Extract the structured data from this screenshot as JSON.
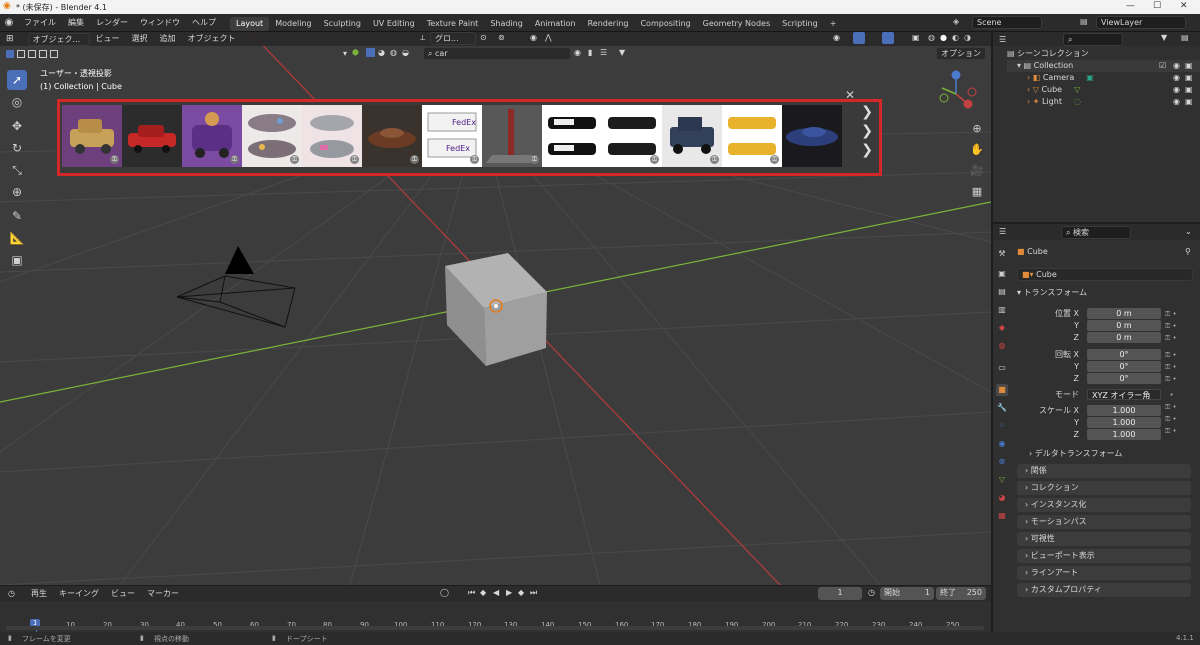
{
  "window": {
    "title": "* (未保存) - Blender 4.1"
  },
  "menu": [
    "ファイル",
    "編集",
    "レンダー",
    "ウィンドウ",
    "ヘルプ"
  ],
  "workspaces": [
    "Layout",
    "Modeling",
    "Sculpting",
    "UV Editing",
    "Texture Paint",
    "Shading",
    "Animation",
    "Rendering",
    "Compositing",
    "Geometry Nodes",
    "Scripting"
  ],
  "scene": {
    "name": "Scene",
    "view_layer": "ViewLayer"
  },
  "viewport": {
    "mode": "オブジェク...",
    "menus": [
      "ビュー",
      "選択",
      "追加",
      "オブジェクト"
    ],
    "transform_orientation": "グロ...",
    "search_value": "car",
    "options_label": "オプション",
    "overlay_title": "ユーザー・透視投影",
    "overlay_sub": "(1) Collection | Cube",
    "fedex_text": "FedEx"
  },
  "outliner": {
    "scene_collection": "シーンコレクション",
    "collection": "Collection",
    "items": [
      "Camera",
      "Cube",
      "Light"
    ]
  },
  "properties": {
    "search_placeholder": "検索",
    "object_name": "Cube",
    "data_name": "Cube",
    "transform_header": "トランスフォーム",
    "location_label": "位置 X",
    "rotation_label": "回転 X",
    "scale_label": "スケール X",
    "y_label": "Y",
    "z_label": "Z",
    "location": [
      "0 m",
      "0 m",
      "0 m"
    ],
    "rotation": [
      "0°",
      "0°",
      "0°"
    ],
    "mode_label": "モード",
    "rotation_mode": "XYZ オイラー角",
    "scale": [
      "1.000",
      "1.000",
      "1.000"
    ],
    "delta_transform": "デルタトランスフォーム",
    "panels": [
      "関係",
      "コレクション",
      "インスタンス化",
      "モーションパス",
      "可視性",
      "ビューポート表示",
      "ラインアート",
      "カスタムプロパティ"
    ]
  },
  "timeline": {
    "menus": [
      "再生",
      "キーイング",
      "ビュー",
      "マーカー"
    ],
    "current_frame": "1",
    "start_label": "開始",
    "start": "1",
    "end_label": "終了",
    "end": "250",
    "ticks": [
      "1",
      "10",
      "20",
      "30",
      "40",
      "50",
      "60",
      "70",
      "80",
      "90",
      "100",
      "110",
      "120",
      "130",
      "140",
      "150",
      "160",
      "170",
      "180",
      "190",
      "200",
      "210",
      "220",
      "230",
      "240",
      "250"
    ]
  },
  "status": {
    "left": "フレームを変更",
    "middle": "視点の移動",
    "right": "ドープシート",
    "version": "4.1.1"
  },
  "colors": {
    "accent": "#4a6fb8",
    "highlight": "#d42828",
    "x_axis": "#b83a3a",
    "y_axis": "#7bb33a"
  }
}
